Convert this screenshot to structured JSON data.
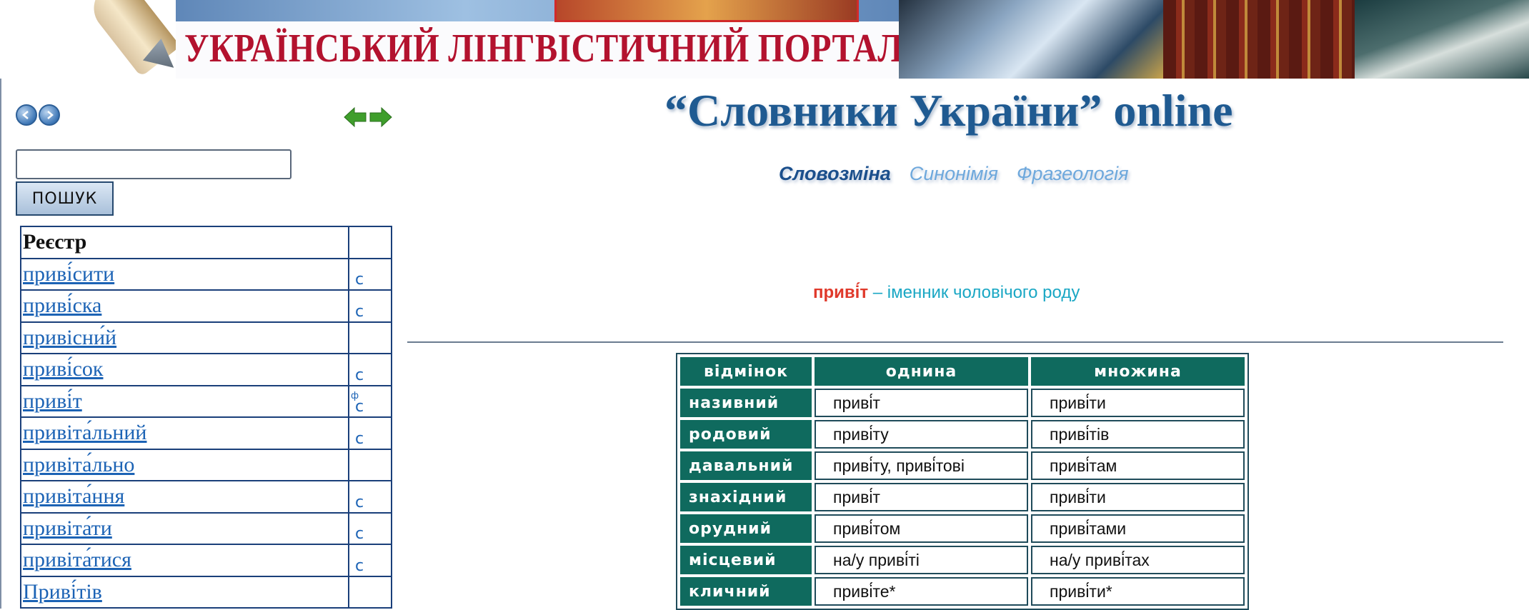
{
  "banner": {
    "title": "УКРАЇНСЬКИЙ ЛІНГВІСТИЧНИЙ ПОРТАЛ"
  },
  "left": {
    "search": {
      "value": "",
      "button_label": "ПОШУК"
    },
    "registry": {
      "header": "Реєстр",
      "items": [
        {
          "word": "приві́сити",
          "flag": "с",
          "flag_sup": ""
        },
        {
          "word": "приві́ска",
          "flag": "с",
          "flag_sup": ""
        },
        {
          "word": "привісни́й",
          "flag": "",
          "flag_sup": ""
        },
        {
          "word": "приві́сок",
          "flag": "с",
          "flag_sup": ""
        },
        {
          "word": "приві́т",
          "flag": "с",
          "flag_sup": "ф"
        },
        {
          "word": "привіта́льний",
          "flag": "с",
          "flag_sup": ""
        },
        {
          "word": "привіта́льно",
          "flag": "",
          "flag_sup": ""
        },
        {
          "word": "привіта́ння",
          "flag": "с",
          "flag_sup": ""
        },
        {
          "word": "привіта́ти",
          "flag": "с",
          "flag_sup": ""
        },
        {
          "word": "привіта́тися",
          "flag": "с",
          "flag_sup": ""
        },
        {
          "word": "Приві́тів",
          "flag": "",
          "flag_sup": ""
        }
      ]
    }
  },
  "main": {
    "title": "“Словники України”  online",
    "tabs": [
      "Словозміна",
      "Синонімія",
      "Фразеологія"
    ],
    "definition": {
      "word": "приві́т",
      "desc": " – іменник чоловічого роду"
    },
    "declension": {
      "headers": [
        "відмінок",
        "однина",
        "множина"
      ],
      "rows": [
        {
          "case": "називний",
          "singular": "приві́т",
          "plural": "приві́ти"
        },
        {
          "case": "родовий",
          "singular": "приві́ту",
          "plural": "приві́тів"
        },
        {
          "case": "давальний",
          "singular": "приві́ту, приві́тові",
          "plural": "приві́там"
        },
        {
          "case": "знахідний",
          "singular": "приві́т",
          "plural": "приві́ти"
        },
        {
          "case": "орудний",
          "singular": "приві́том",
          "plural": "приві́тами"
        },
        {
          "case": "місцевий",
          "singular": "на/у приві́ті",
          "plural": "на/у приві́тах"
        },
        {
          "case": "кличний",
          "singular": "приві́те*",
          "plural": "приві́ти*"
        }
      ]
    }
  },
  "colors": {
    "brand_red": "#b3122e",
    "table_green": "#0f6a5e",
    "link_blue": "#1c63b5"
  }
}
